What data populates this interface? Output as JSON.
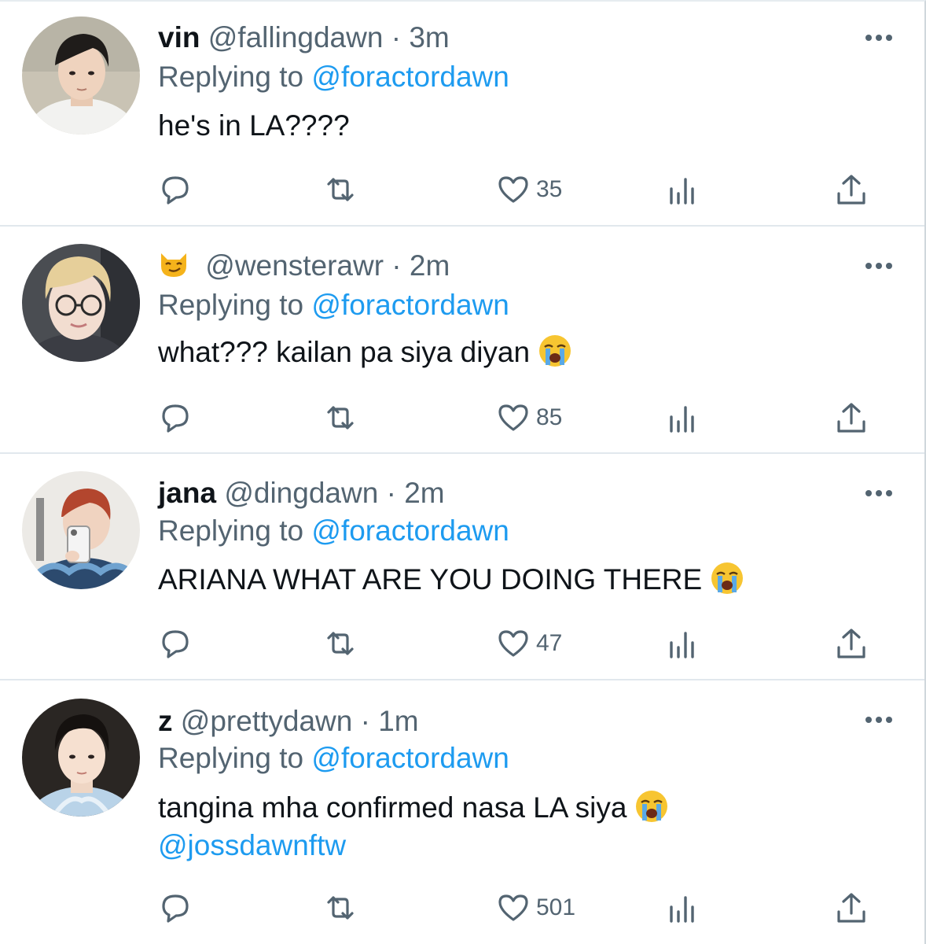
{
  "tweets": [
    {
      "name": "vin",
      "handle": "@fallingdawn",
      "dot": "·",
      "time": "3m",
      "replying_prefix": "Replying to",
      "replying_to": "@foractordawn",
      "text_lines": [
        "he's in LA????"
      ],
      "emoji": "",
      "mention_line": "",
      "likes": "35",
      "avatar": "avatar-photo"
    },
    {
      "name": "",
      "name_emoji": "smirking-cat-emoji",
      "handle": "@wensterawr",
      "dot": "·",
      "time": "2m",
      "replying_prefix": "Replying to",
      "replying_to": "@foractordawn",
      "text_lines": [
        "what??? kailan pa siya diyan"
      ],
      "emoji": "loudly-crying-emoji",
      "mention_line": "",
      "likes": "85",
      "avatar": "avatar-photo"
    },
    {
      "name": "jana",
      "handle": "@dingdawn",
      "dot": "·",
      "time": "2m",
      "replying_prefix": "Replying to",
      "replying_to": "@foractordawn",
      "text_lines": [
        "ARIANA WHAT ARE YOU DOING THERE"
      ],
      "emoji": "loudly-crying-emoji",
      "mention_line": "",
      "likes": "47",
      "avatar": "avatar-photo"
    },
    {
      "name": "z",
      "handle": "@prettydawn",
      "dot": "·",
      "time": "1m",
      "replying_prefix": "Replying to",
      "replying_to": "@foractordawn",
      "text_lines": [
        "tangina mha confirmed nasa LA siya"
      ],
      "emoji": "loudly-crying-emoji",
      "mention_line": "@jossdawnftw",
      "likes": "501",
      "avatar": "avatar-photo"
    }
  ],
  "colors": {
    "link": "#1d9bf0",
    "secondary_text": "#536471",
    "primary_text": "#0f1419",
    "divider": "#e1e8ed"
  },
  "icons": {
    "reply": "reply-icon",
    "retweet": "retweet-icon",
    "like": "heart-icon",
    "views": "analytics-icon",
    "share": "share-icon",
    "more": "more-dots-icon"
  }
}
